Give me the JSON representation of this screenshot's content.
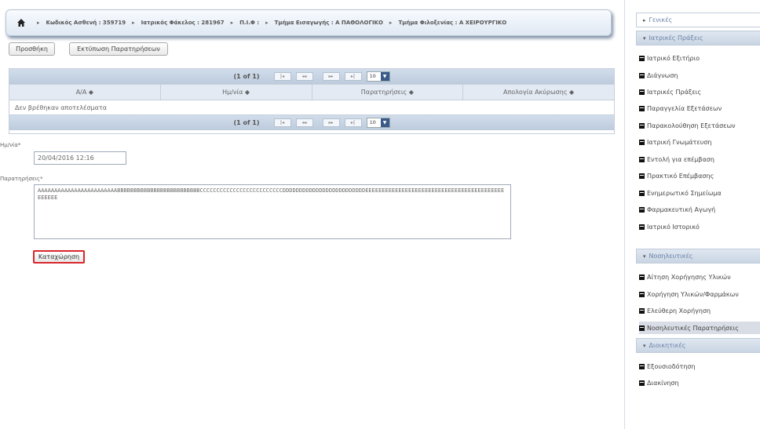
{
  "breadcrumb": {
    "items": [
      "Κωδικός Ασθενή : 359719",
      "Ιατρικός Φάκελος : 281967",
      "Π.Ι.Φ :",
      "Τμήμα Εισαγωγής : Α ΠΑΘΟΛΟΓΙΚΟ",
      "Τμήμα Φιλοξενίας : Α ΧΕΙΡΟΥΡΓΙΚΟ"
    ]
  },
  "toolbar": {
    "add_label": "Προσθήκη",
    "print_label": "Εκτύπωση Παρατηρήσεων"
  },
  "table": {
    "page_info": "(1 of 1)",
    "rows_per_page": "10",
    "pager_first": "|◂",
    "pager_prev": "◂◂",
    "pager_next": "▸▸",
    "pager_last": "▸|",
    "columns": [
      "Α/Α ◆",
      "Ημ/νία ◆",
      "Παρατηρήσεις ◆",
      "Απολογία Ακύρωσης ◆"
    ],
    "empty_message": "Δεν βρέθηκαν αποτελέσματα"
  },
  "form": {
    "date_label": "Ημ/νία*",
    "date_value": "20/04/2016 12:16",
    "notes_label": "Παρατηρήσεις*",
    "notes_value": "AAAAAAAAAAAAAAAAAAAAAAAABBBBBBBBBBBBBBBBBBBBBBBBBCCCCCCCCCCCCCCCCCCCCCCCCCDDDDDDDDDDDDDDDDDDDDDDDDDEEEEEEEEEEEEEEEEEEEEEEEEEEEEEEEEEEEEEEEEEEEEEEEE",
    "submit_label": "Καταχώρηση"
  },
  "sidebar": {
    "sections": [
      {
        "title": "Γενικές",
        "collapsed": true
      },
      {
        "title": "Ιατρικές Πράξεις",
        "collapsed": false
      },
      {
        "title": "Νοσηλευτικές",
        "collapsed": false
      },
      {
        "title": "Διοικητικές",
        "collapsed": false
      }
    ],
    "medical_items": [
      "Ιατρικό Εξιτήριο",
      "Διάγνωση",
      "Ιατρικές Πράξεις",
      "Παραγγελία Εξετάσεων",
      "Παρακολούθηση Εξετάσεων",
      "Ιατρική Γνωμάτευση",
      "Εντολή για επέμβαση",
      "Πρακτικό Επέμβασης",
      "Ενημερωτικό Σημείωμα",
      "Φαρμακευτική Αγωγή",
      "Ιατρικό Ιστορικό"
    ],
    "nursing_items": [
      "Αίτηση Χορήγησης Υλικών",
      "Χορήγηση Υλικών/Φαρμάκων",
      "Ελεύθερη Χορήγηση",
      "Νοσηλευτικές Παρατηρήσεις"
    ],
    "admin_items": [
      "Εξουσιοδότηση",
      "Διακίνηση"
    ]
  },
  "colors": {
    "accent": "#6b82a8",
    "submit_border": "#d9262c",
    "header_bg": "#c9d5e3"
  }
}
